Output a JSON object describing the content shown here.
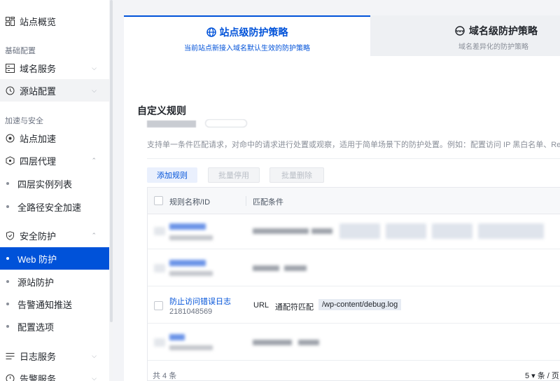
{
  "sidebar": {
    "items": [
      {
        "label": "站点概览",
        "icon": "grid-icon"
      },
      {
        "label": "域名服务",
        "icon": "domain-icon"
      },
      {
        "label": "源站配置",
        "icon": "origin-icon"
      },
      {
        "label": "站点加速",
        "icon": "accelerate-icon"
      },
      {
        "label": "四层代理",
        "icon": "proxy-icon"
      },
      {
        "label": "安全防护",
        "icon": "shield-icon"
      },
      {
        "label": "日志服务",
        "icon": "log-icon"
      },
      {
        "label": "告警服务",
        "icon": "alarm-icon"
      }
    ],
    "groups": [
      "基础配置",
      "加速与安全"
    ],
    "sub_items": [
      "四层实例列表",
      "全路径安全加速",
      "Web 防护",
      "源站防护",
      "告警通知推送",
      "配置选项"
    ]
  },
  "tabs": {
    "site": {
      "title": "站点级防护策略",
      "subtitle": "当前站点新接入域名默认生效的防护策略"
    },
    "domain": {
      "title": "域名级防护策略",
      "subtitle": "域名差异化的防护策略"
    }
  },
  "section_title": "自定义规则",
  "rules": {
    "description": "支持单一条件匹配请求，对命中的请求进行处置或观察，适用于简单场景下的防护处置。例如：配置访问 IP 黑白名单、Referer 黑名",
    "buttons": {
      "add": "添加规则",
      "disable": "批量停用",
      "delete": "批量删除"
    },
    "columns": [
      "规则名称/ID",
      "匹配条件"
    ],
    "visible_row": {
      "name": "防止访问错误日志",
      "id": "2181048569",
      "field": "URL",
      "operator": "通配符匹配",
      "value": "/wp-content/debug.log"
    },
    "footer": {
      "count": "共 4 条",
      "page_size": "5 ▾ 条 / 页"
    }
  },
  "colors": {
    "accent": "#0052d9"
  }
}
